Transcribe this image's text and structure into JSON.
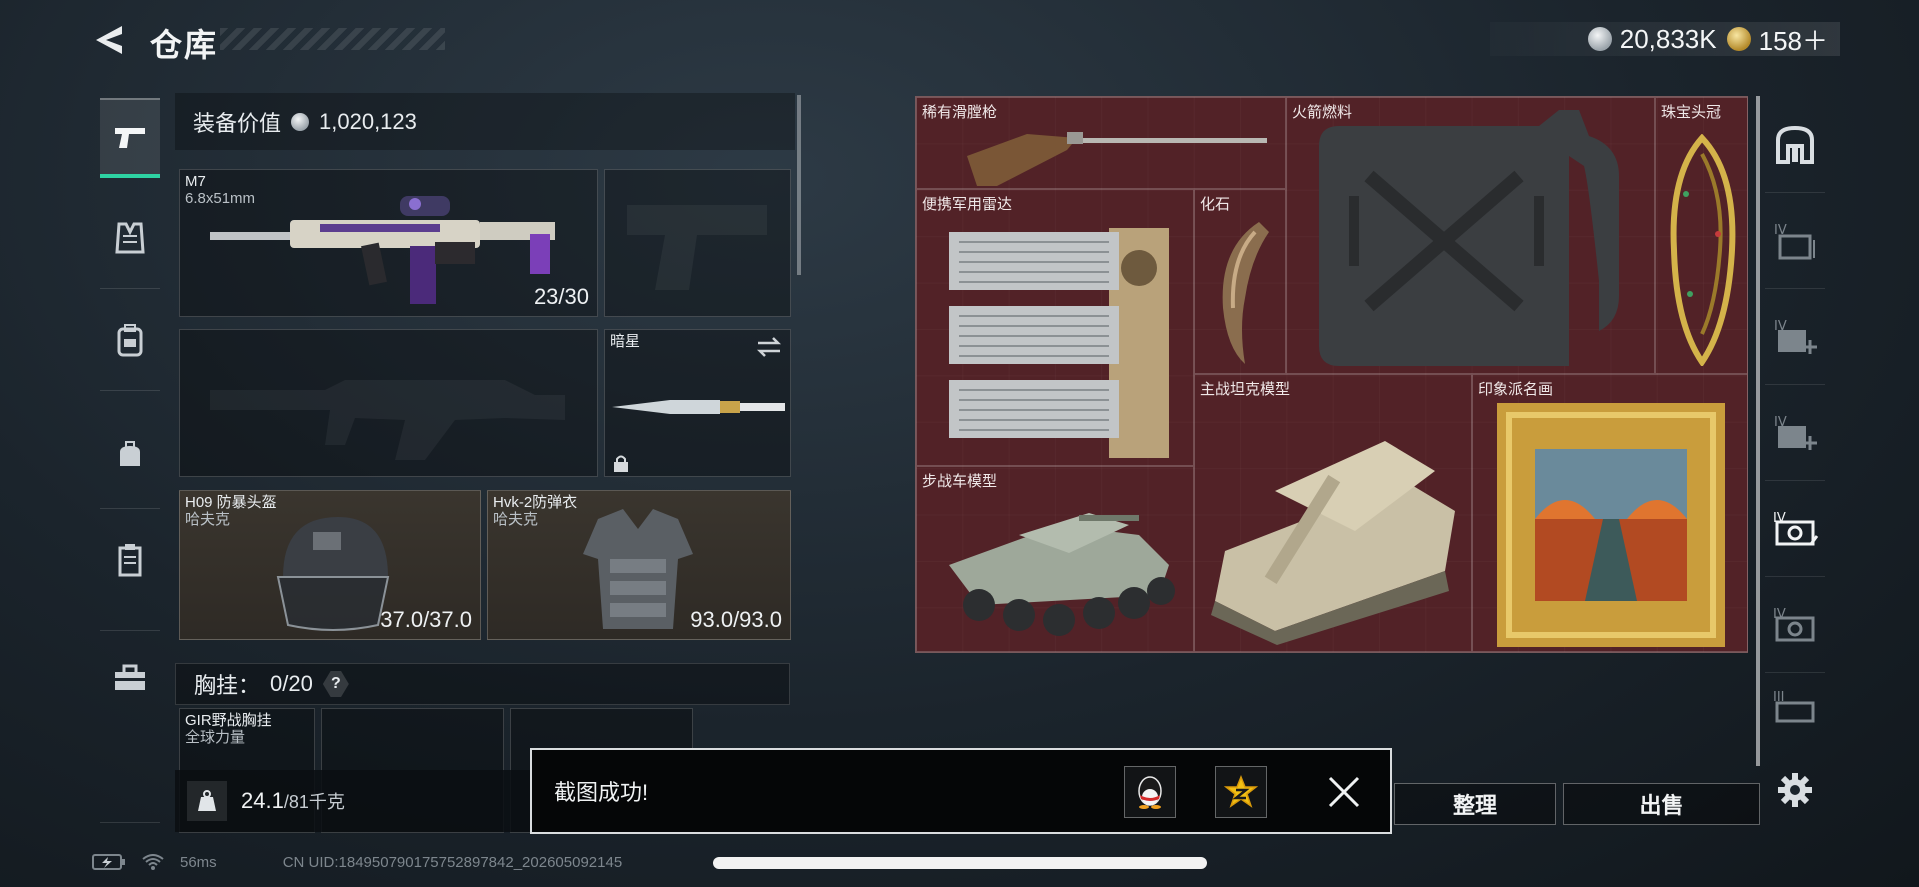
{
  "header": {
    "title": "仓库",
    "currency": [
      {
        "icon": "silver-coin-icon",
        "value": "20,833K"
      },
      {
        "icon": "gold-coin-icon",
        "value": "158＋"
      }
    ]
  },
  "left_tabs": [
    {
      "name": "pistol-icon",
      "active": true
    },
    {
      "name": "vest-icon"
    },
    {
      "name": "backpack-icon"
    },
    {
      "name": "pouch-icon"
    },
    {
      "name": "case-icon"
    },
    {
      "name": "toolbox-icon"
    }
  ],
  "loadout": {
    "equip_value_label": "装备价值",
    "equip_value": "1,020,123",
    "primary": {
      "name": "M7",
      "ammo_type": "6.8x51mm",
      "ammo": "23/30"
    },
    "melee": {
      "name": "暗星"
    },
    "helmet": {
      "name": "H09 防暴头盔",
      "brand": "哈夫克",
      "durability": "37.0/37.0"
    },
    "armor": {
      "name": "Hvk-2防弹衣",
      "brand": "哈夫克",
      "durability": "93.0/93.0"
    },
    "chest_rig": {
      "label": "胸挂：",
      "capacity": "0/20",
      "help": "?"
    },
    "chest_item": {
      "name": "GIR野战胸挂",
      "brand": "全球力量"
    },
    "weight_value": "24.1",
    "weight_max": "/81千克"
  },
  "storage_items": [
    {
      "key": "rifle",
      "name": "稀有滑膛枪"
    },
    {
      "key": "fuel",
      "name": "火箭燃料"
    },
    {
      "key": "crown",
      "name": "珠宝头冠"
    },
    {
      "key": "radar",
      "name": "便携军用雷达"
    },
    {
      "key": "fossil",
      "name": "化石"
    },
    {
      "key": "tank",
      "name": "主战坦克模型"
    },
    {
      "key": "painting",
      "name": "印象派名画"
    },
    {
      "key": "ifv",
      "name": "步战车模型"
    }
  ],
  "right_filters": [
    "home-icon",
    "tier4-folder-icon",
    "tier4-medkit-icon",
    "tier4-plus-icon",
    "tier4-camera-icon",
    "tier4-camera-alt-icon",
    "tier3-camera-icon"
  ],
  "actions": {
    "sort": "整理",
    "sell": "出售"
  },
  "toast": {
    "message": "截图成功!"
  },
  "status": {
    "ping": "56ms",
    "uid": "CN UID:184950790175752897842_202605092145"
  }
}
